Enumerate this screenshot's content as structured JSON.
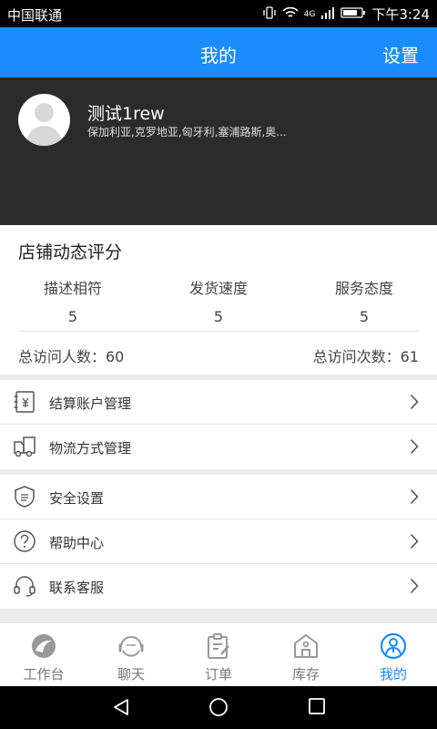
{
  "statusbar": {
    "carrier": "中国联通",
    "network": "4G",
    "time": "下午3:24"
  },
  "titlebar": {
    "title": "我的",
    "settings": "设置"
  },
  "profile": {
    "name": "测试1rew",
    "description": "保加利亚,克罗地亚,匈牙利,塞浦路斯,奥..."
  },
  "rating": {
    "heading": "店铺动态评分",
    "columns": [
      {
        "label": "描述相符",
        "value": "5"
      },
      {
        "label": "发货速度",
        "value": "5"
      },
      {
        "label": "服务态度",
        "value": "5"
      }
    ],
    "visitors": "总访问人数：60",
    "visits": "总访问次数：61"
  },
  "menu": {
    "group1": [
      {
        "label": "结算账户管理",
        "icon": "account-book-icon"
      },
      {
        "label": "物流方式管理",
        "icon": "truck-icon"
      }
    ],
    "group2": [
      {
        "label": "安全设置",
        "icon": "shield-icon"
      },
      {
        "label": "帮助中心",
        "icon": "question-circle-icon"
      },
      {
        "label": "联系客服",
        "icon": "headset-icon"
      }
    ]
  },
  "tabs": [
    {
      "label": "工作台",
      "icon": "workbench-icon",
      "active": false
    },
    {
      "label": "聊天",
      "icon": "chat-icon",
      "active": false
    },
    {
      "label": "订单",
      "icon": "clipboard-icon",
      "active": false
    },
    {
      "label": "库存",
      "icon": "warehouse-icon",
      "active": false
    },
    {
      "label": "我的",
      "icon": "user-icon",
      "active": true
    }
  ],
  "colors": {
    "accent": "#1a8cff",
    "profile_bg": "#2b2b2b",
    "icon_gray": "#999999"
  }
}
